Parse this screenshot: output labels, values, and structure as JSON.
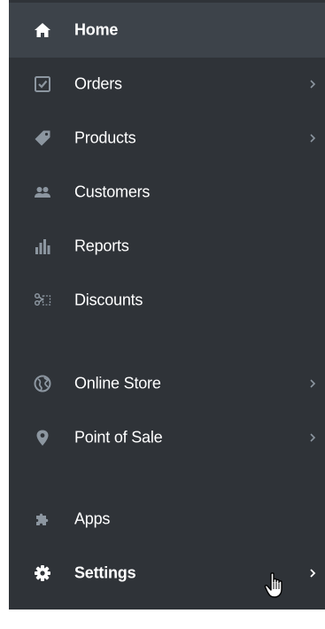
{
  "sidebar": {
    "items": [
      {
        "label": "Home",
        "icon": "home-icon",
        "active": true,
        "chevron": false
      },
      {
        "label": "Orders",
        "icon": "orders-icon",
        "active": false,
        "chevron": true
      },
      {
        "label": "Products",
        "icon": "tag-icon",
        "active": false,
        "chevron": true
      },
      {
        "label": "Customers",
        "icon": "customers-icon",
        "active": false,
        "chevron": false
      },
      {
        "label": "Reports",
        "icon": "bar-chart-icon",
        "active": false,
        "chevron": false
      },
      {
        "label": "Discounts",
        "icon": "discount-scissors-icon",
        "active": false,
        "chevron": false
      },
      {
        "label": "Online Store",
        "icon": "globe-icon",
        "active": false,
        "chevron": true
      },
      {
        "label": "Point of Sale",
        "icon": "map-pin-icon",
        "active": false,
        "chevron": true
      },
      {
        "label": "Apps",
        "icon": "puzzle-icon",
        "active": false,
        "chevron": false
      },
      {
        "label": "Settings",
        "icon": "gear-icon",
        "active": false,
        "chevron": true
      }
    ]
  },
  "colors": {
    "sidebar_bg": "#2f3338",
    "active_bg": "#3d434a",
    "icon": "#8c96a0",
    "icon_active": "#ffffff",
    "text": "#ffffff",
    "chevron": "#8c96a0"
  }
}
